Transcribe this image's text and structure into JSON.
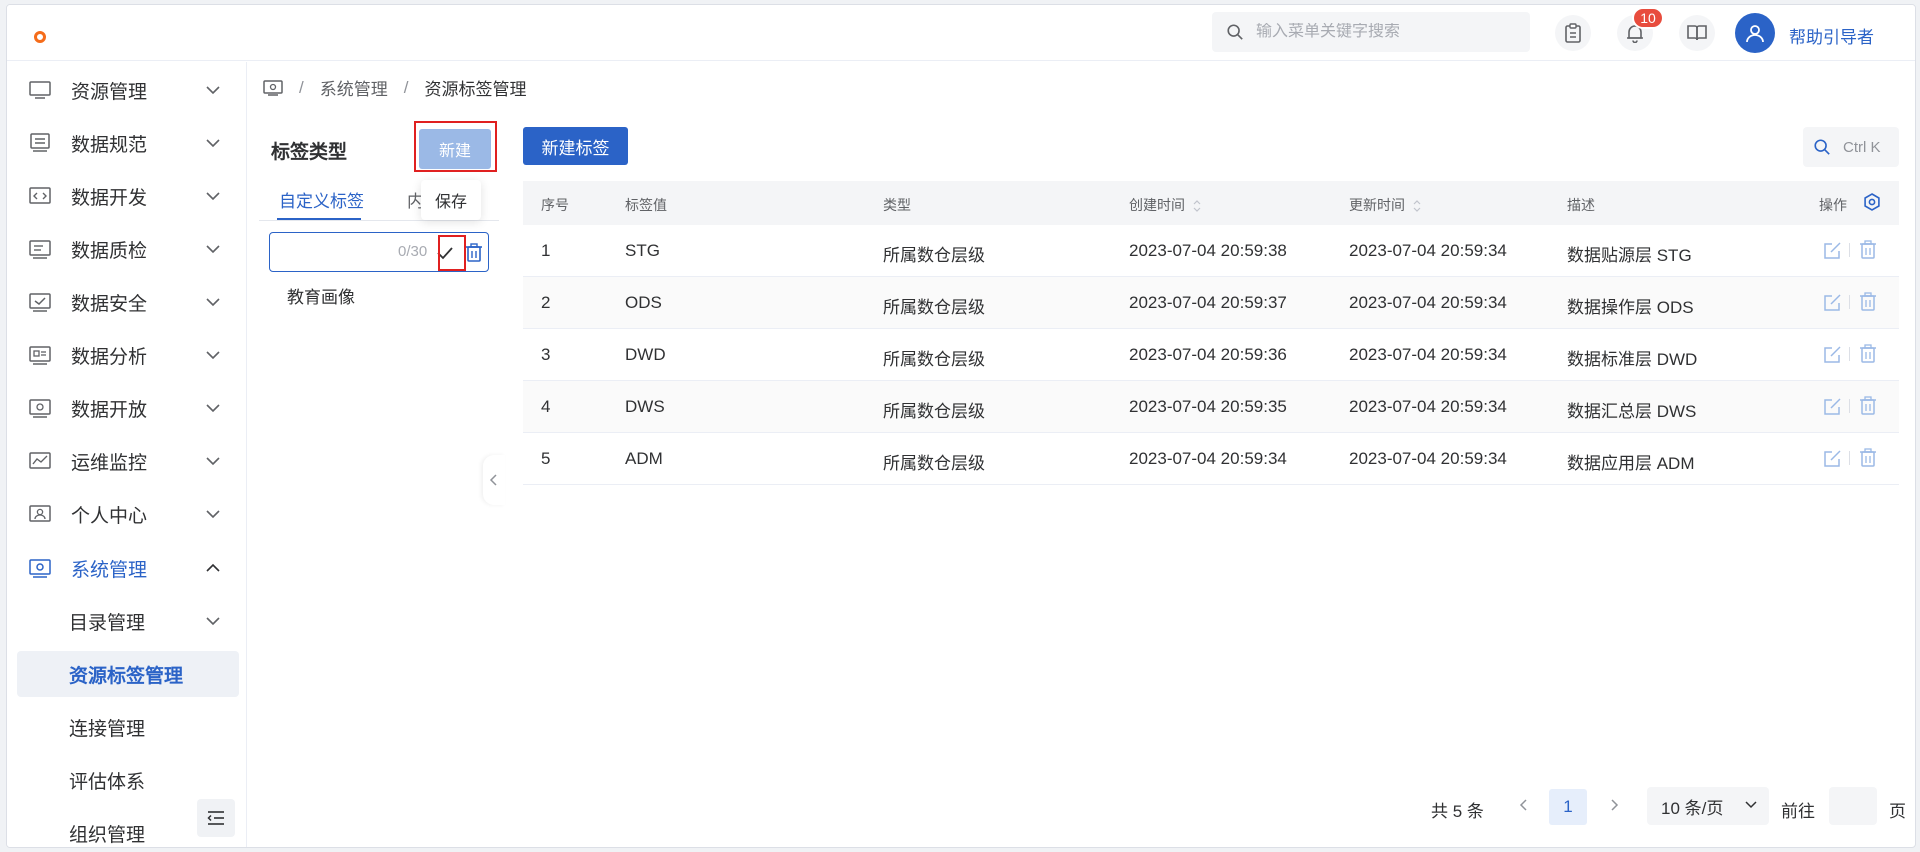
{
  "header": {
    "search_placeholder": "输入菜单关键字搜索",
    "notification_count": "10",
    "username": "帮助引导者"
  },
  "sidebar": {
    "items": [
      {
        "label": "资源管理"
      },
      {
        "label": "数据规范"
      },
      {
        "label": "数据开发"
      },
      {
        "label": "数据质检"
      },
      {
        "label": "数据安全"
      },
      {
        "label": "数据分析"
      },
      {
        "label": "数据开放"
      },
      {
        "label": "运维监控"
      },
      {
        "label": "个人中心"
      },
      {
        "label": "系统管理"
      }
    ],
    "sub_items": [
      {
        "label": "目录管理"
      },
      {
        "label": "资源标签管理"
      },
      {
        "label": "连接管理"
      },
      {
        "label": "评估体系"
      },
      {
        "label": "组织管理"
      }
    ]
  },
  "breadcrumb": {
    "sep": "/",
    "level1": "系统管理",
    "level2": "资源标签管理"
  },
  "left_panel": {
    "title": "标签类型",
    "new_label": "新建",
    "tab_custom": "自定义标签",
    "tab_builtin": "内",
    "tooltip": "保存",
    "input_value": "",
    "counter": "0/30",
    "tag_items": [
      "教育画像"
    ]
  },
  "main": {
    "new_tag_label": "新建标签",
    "search_hint": "Ctrl K",
    "columns": {
      "index": "序号",
      "value": "标签值",
      "type": "类型",
      "created": "创建时间",
      "updated": "更新时间",
      "desc": "描述",
      "actions": "操作"
    },
    "rows": [
      {
        "index": "1",
        "value": "STG",
        "type": "所属数仓层级",
        "created": "2023-07-04 20:59:38",
        "updated": "2023-07-04 20:59:34",
        "desc": "数据贴源层 STG"
      },
      {
        "index": "2",
        "value": "ODS",
        "type": "所属数仓层级",
        "created": "2023-07-04 20:59:37",
        "updated": "2023-07-04 20:59:34",
        "desc": "数据操作层 ODS"
      },
      {
        "index": "3",
        "value": "DWD",
        "type": "所属数仓层级",
        "created": "2023-07-04 20:59:36",
        "updated": "2023-07-04 20:59:34",
        "desc": "数据标准层 DWD"
      },
      {
        "index": "4",
        "value": "DWS",
        "type": "所属数仓层级",
        "created": "2023-07-04 20:59:35",
        "updated": "2023-07-04 20:59:34",
        "desc": "数据汇总层 DWS"
      },
      {
        "index": "5",
        "value": "ADM",
        "type": "所属数仓层级",
        "created": "2023-07-04 20:59:34",
        "updated": "2023-07-04 20:59:34",
        "desc": "数据应用层 ADM"
      }
    ],
    "pagination": {
      "total": "共 5 条",
      "current": "1",
      "page_size": "10 条/页",
      "goto": "前往",
      "page_suffix": "页"
    }
  },
  "colors": {
    "primary": "#2b63c7",
    "highlight": "#e02020",
    "badge": "#e84c3d"
  }
}
